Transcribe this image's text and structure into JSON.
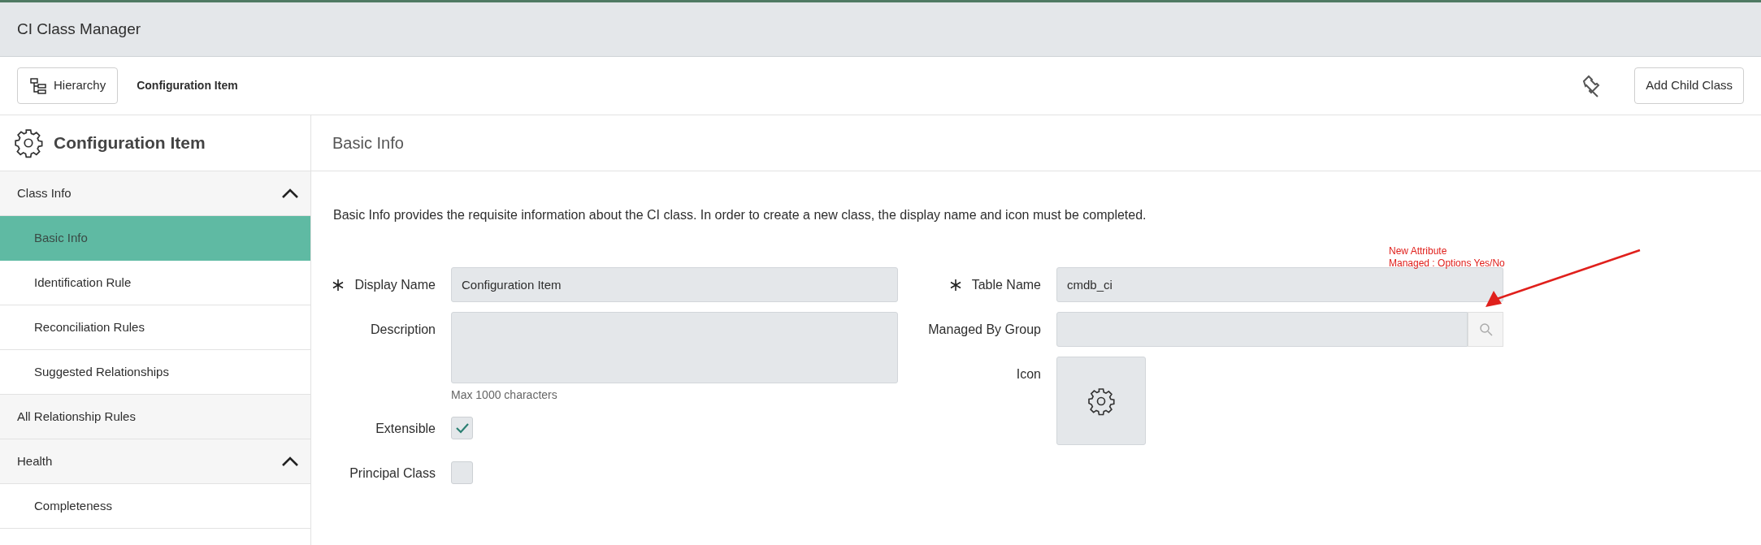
{
  "header": {
    "title": "CI Class Manager"
  },
  "toolbar": {
    "hierarchy_button": "Hierarchy",
    "breadcrumb": "Configuration Item",
    "add_button": "Add Child Class"
  },
  "sidebar": {
    "title": "Configuration Item",
    "sections": [
      {
        "label": "Class Info",
        "selected": false,
        "expanded": true,
        "children": [
          {
            "label": "Basic Info",
            "selected": true
          },
          {
            "label": "Identification Rule",
            "selected": false
          },
          {
            "label": "Reconciliation Rules",
            "selected": false
          },
          {
            "label": "Suggested Relationships",
            "selected": false
          }
        ]
      },
      {
        "label": "All Relationship Rules",
        "selected": false
      },
      {
        "label": "Health",
        "selected": false,
        "expanded": true,
        "children": [
          {
            "label": "Completeness",
            "selected": false
          }
        ]
      }
    ]
  },
  "main": {
    "title": "Basic Info",
    "intro": "Basic Info provides the requisite information about the CI class. In order to create a new class, the display name and icon must be completed.",
    "left_fields": [
      {
        "kind": "text",
        "label": "Display Name",
        "required": true,
        "value": "Configuration Item"
      },
      {
        "kind": "textarea",
        "label": "Description",
        "required": false,
        "hint": "Max 1000 characters"
      },
      {
        "kind": "checkbox",
        "label": "Extensible",
        "required": false,
        "checked": true
      },
      {
        "kind": "checkbox",
        "label": "Principal Class",
        "required": false,
        "checked": false
      }
    ],
    "right_fields": [
      {
        "kind": "text",
        "label": "Table Name",
        "required": true,
        "value": "cmdb_ci"
      },
      {
        "kind": "lookup",
        "label": "Managed By Group",
        "required": false
      },
      {
        "kind": "icon",
        "label": "Icon",
        "required": false
      }
    ]
  },
  "annotation": {
    "lines": [
      "New Attribute",
      "Managed : Options Yes/No"
    ]
  }
}
